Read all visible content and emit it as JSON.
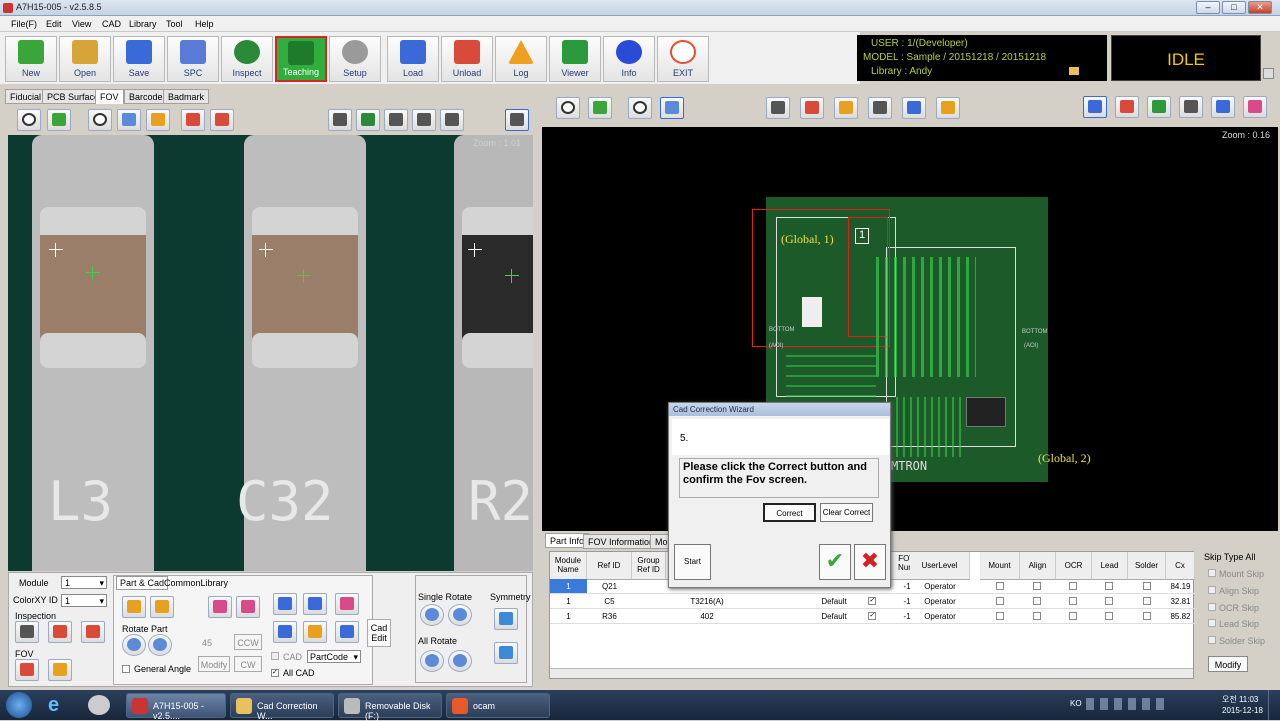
{
  "window": {
    "title": "A7H15-005 - v2.5.8.5"
  },
  "menu": [
    "File(F)",
    "Edit",
    "View",
    "CAD",
    "Library",
    "Tool",
    "Help"
  ],
  "toolbar": [
    {
      "label": "New",
      "icon": "new-job-icon",
      "color": "#3aa63a"
    },
    {
      "label": "Open",
      "icon": "open-job-icon",
      "color": "#d8a43a"
    },
    {
      "label": "Save",
      "icon": "save-job-icon",
      "color": "#3a6ad8"
    },
    {
      "label": "SPC",
      "icon": "spc-icon",
      "color": "#5a7ad8"
    },
    {
      "label": "Inspect",
      "icon": "inspect-icon",
      "color": "#2a8a3a"
    },
    {
      "label": "Teaching",
      "icon": "teaching-icon",
      "color": "#1e7a2c"
    },
    {
      "label": "Setup",
      "icon": "setup-gear-icon",
      "color": "#9a9a9a"
    },
    {
      "label": "Load",
      "icon": "load-icon",
      "color": "#3a6ad8"
    },
    {
      "label": "Unload",
      "icon": "unload-icon",
      "color": "#d84a3a"
    },
    {
      "label": "Log",
      "icon": "log-warning-icon",
      "color": "#f0a020"
    },
    {
      "label": "Viewer",
      "icon": "viewer-icon",
      "color": "#2a9a3a"
    },
    {
      "label": "Info",
      "icon": "info-icon",
      "color": "#2a4ad8"
    },
    {
      "label": "EXIT",
      "icon": "exit-icon",
      "color": "#e0502a"
    }
  ],
  "info": {
    "user": "USER :  1/(Developer)",
    "model": "MODEL :  Sample / 20151218 / 20151218",
    "library": "Library :  Andy"
  },
  "status": "IDLE",
  "left_tabs": [
    "Fiducial",
    "PCB Surface",
    "FOV",
    "Barcode",
    "Badmark"
  ],
  "fov_view": {
    "zoom": "Zoom : 1.01",
    "labels": [
      "L3",
      "C32",
      "R2"
    ]
  },
  "left_panel": {
    "module_label": "Module",
    "module_value": "1",
    "colorxy_label": "ColorXY ID",
    "colorxy_value": "1",
    "inspection_label": "Inspection",
    "fov_label": "FOV",
    "tabs": [
      "Part & Cad",
      "CommonLibrary"
    ],
    "rotate_part": "Rotate Part",
    "angle_value": "45",
    "ccw": "CCW",
    "cw": "CW",
    "modify": "Modify",
    "general_angle": "General Angle",
    "cad": "CAD",
    "all_cad": "All CAD",
    "partcode": "PartCode",
    "cad_edit": "Cad Edit",
    "single_rotate": "Single Rotate",
    "all_rotate": "All Rotate",
    "symmetry": "Symmetry"
  },
  "main_view": {
    "zoom": "Zoom : 0.16",
    "global1": "(Global, 1)",
    "global2": "(Global, 2)",
    "marker": "1",
    "bottom_left": "BOTTOM",
    "bottom_right": "BOTTOM",
    "aoi": "(AOI)",
    "brand": "MTRON"
  },
  "wizard": {
    "title": "Cad Correction Wizard",
    "step": "5.",
    "message": "Please click the Correct button and confirm the Fov screen.",
    "correct": "Correct",
    "clear_correct": "Clear Correct",
    "start": "Start"
  },
  "bottom_tabs": [
    "Part Info",
    "FOV Information",
    "Mo"
  ],
  "grid": {
    "headers": [
      "Module Name",
      "Ref ID",
      "Group Ref ID",
      "",
      "",
      "",
      "FOV Num",
      "UserLevel",
      "Mount",
      "Align",
      "OCR",
      "Lead",
      "Solder",
      "Cx"
    ],
    "rows": [
      {
        "module": "1",
        "ref": "Q21",
        "group": "",
        "part": "",
        "level": "",
        "fov": "-1",
        "user": "Operator",
        "cx": "84.19"
      },
      {
        "module": "1",
        "ref": "C5",
        "group": "",
        "part": "T3216(A)",
        "level": "Default",
        "fov": "-1",
        "user": "Operator",
        "cx": "32.81"
      },
      {
        "module": "1",
        "ref": "R36",
        "group": "",
        "part": "402",
        "level": "Default",
        "fov": "-1",
        "user": "Operator",
        "cx": "85.82"
      }
    ]
  },
  "skip": {
    "title": "Skip Type All",
    "items": [
      "Mount Skip",
      "Align Skip",
      "OCR Skip",
      "Lead Skip",
      "Solder Skip"
    ],
    "modify": "Modify"
  },
  "taskbar": {
    "items": [
      "A7H15-005 - v2.5....",
      "Cad Correction W...",
      "Removable Disk (F:)",
      "ocam"
    ],
    "lang": "KO",
    "time": "오전 11:03",
    "date": "2015-12-18"
  }
}
